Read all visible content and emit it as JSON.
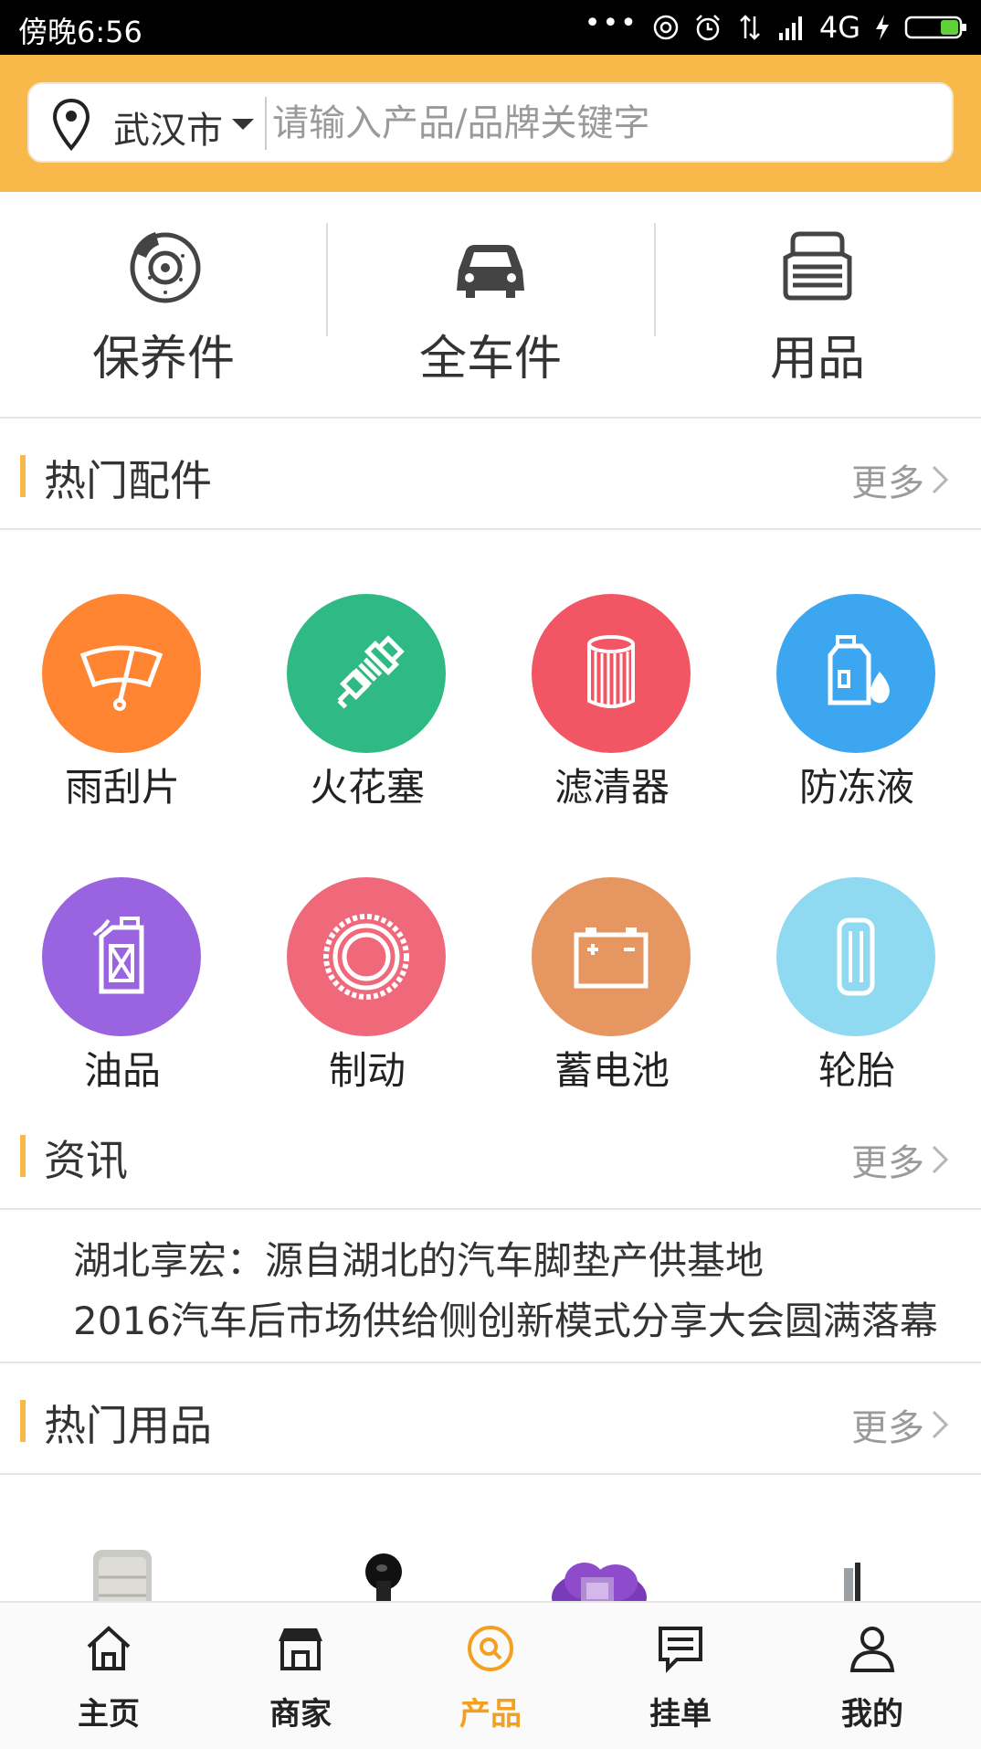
{
  "status_bar": {
    "time": "傍晚6:56",
    "dots": "•••",
    "network": "4G"
  },
  "search": {
    "city": "武汉市",
    "placeholder": "请输入产品/品牌关键字"
  },
  "categories": [
    {
      "label": "保养件",
      "icon": "brake-disc-icon"
    },
    {
      "label": "全车件",
      "icon": "car-icon"
    },
    {
      "label": "用品",
      "icon": "seat-icon"
    }
  ],
  "hot_parts": {
    "title": "热门配件",
    "more": "更多",
    "items": [
      {
        "label": "雨刮片",
        "icon": "wiper-icon",
        "color": "#ff8533"
      },
      {
        "label": "火花塞",
        "icon": "spark-plug-icon",
        "color": "#2eb985"
      },
      {
        "label": "滤清器",
        "icon": "filter-icon",
        "color": "#f25563"
      },
      {
        "label": "防冻液",
        "icon": "antifreeze-icon",
        "color": "#3da6f0"
      },
      {
        "label": "油品",
        "icon": "oil-can-icon",
        "color": "#9a63e0"
      },
      {
        "label": "制动",
        "icon": "brake-icon",
        "color": "#f0697b"
      },
      {
        "label": "蓄电池",
        "icon": "battery-icon",
        "color": "#e69660"
      },
      {
        "label": "轮胎",
        "icon": "tire-icon",
        "color": "#8fdaf0"
      }
    ]
  },
  "news": {
    "title": "资讯",
    "more": "更多",
    "items": [
      "湖北享宏：源自湖北的汽车脚垫产供基地",
      "2016汽车后市场供给侧创新模式分享大会圆满落幕"
    ]
  },
  "hot_goods": {
    "title": "热门用品",
    "more": "更多"
  },
  "bottom_nav": {
    "items": [
      {
        "label": "主页",
        "icon": "home-icon"
      },
      {
        "label": "商家",
        "icon": "shop-icon"
      },
      {
        "label": "产品",
        "icon": "product-search-icon",
        "active": true
      },
      {
        "label": "挂单",
        "icon": "message-icon"
      },
      {
        "label": "我的",
        "icon": "user-icon"
      }
    ]
  },
  "colors": {
    "accent": "#f9b84a",
    "nav_active": "#f3a020"
  }
}
